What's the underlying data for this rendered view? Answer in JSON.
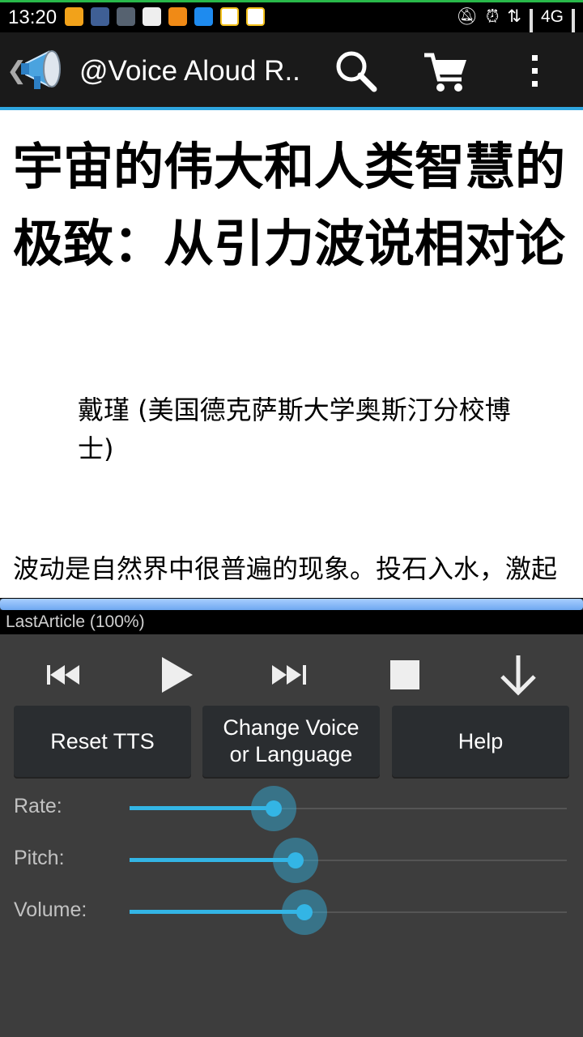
{
  "status_bar": {
    "time": "13:20",
    "network": "4G",
    "left_icons": [
      "mail-icon",
      "app-icon",
      "app-icon",
      "mail-icon",
      "chat-icon",
      "clock-icon",
      "checklist-icon",
      "checklist-icon"
    ],
    "right_icons": [
      "alarm-muted-icon",
      "alarm-icon",
      "data-arrows-icon",
      "signal-icon",
      "signal-icon"
    ]
  },
  "action_bar": {
    "title": "@Voice Aloud R..",
    "icons": [
      "megaphone-icon",
      "search-icon",
      "cart-icon",
      "overflow-menu-icon"
    ]
  },
  "article": {
    "title": "宇宙的伟大和人类智慧的极致：从引力波说相对论",
    "author": "戴瑾 (美国德克萨斯大学奥斯汀分校博士)",
    "paragraph": "波动是自然界中很普遍的现象。投石入水，激起"
  },
  "progress": {
    "fraction": 1.0,
    "label": "LastArticle (100%)"
  },
  "controls": {
    "icons": [
      "previous-icon",
      "play-icon",
      "next-icon",
      "stop-icon",
      "collapse-down-icon"
    ],
    "buttons": {
      "reset": "Reset TTS",
      "change_voice": "Change Voice or Language",
      "help": "Help"
    }
  },
  "sliders": {
    "rate": {
      "label": "Rate:",
      "fraction": 0.33
    },
    "pitch": {
      "label": "Pitch:",
      "fraction": 0.38
    },
    "volume": {
      "label": "Volume:",
      "fraction": 0.4
    }
  },
  "colors": {
    "accent": "#33b5e5",
    "panel_bg": "#3d3d3d",
    "action_bar_bg": "#1a1a1a",
    "button_bg": "#2a2d30"
  }
}
